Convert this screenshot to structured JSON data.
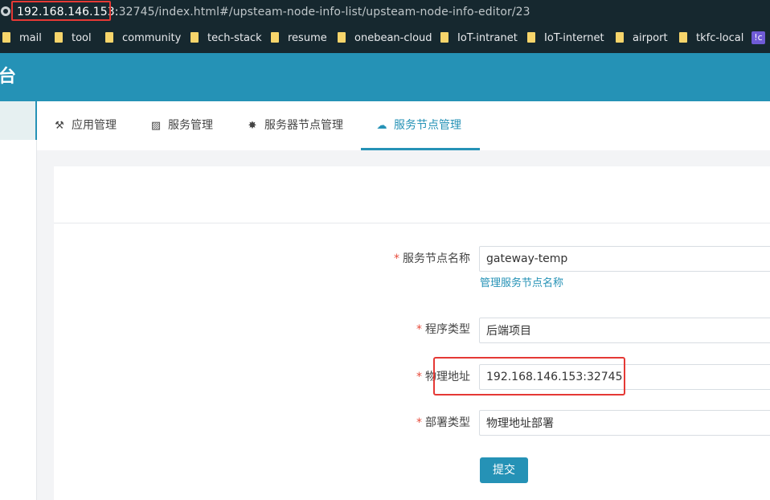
{
  "browser": {
    "url_host": "192.168.146.153:",
    "url_rest": "32745/index.html#/upsteam-node-info-list/upsteam-node-info-editor/23",
    "bookmarks": [
      "mail",
      "tool",
      "community",
      "tech-stack",
      "resume",
      "onebean-cloud",
      "IoT-intranet",
      "IoT-internet",
      "airport",
      "tkfc-local"
    ],
    "extension_glyph": "!c"
  },
  "header": {
    "title": "台"
  },
  "tabs": [
    {
      "label": "应用管理",
      "icon": "tools-icon"
    },
    {
      "label": "服务管理",
      "icon": "chart-icon"
    },
    {
      "label": "服务器节点管理",
      "icon": "server-icon"
    },
    {
      "label": "服务节点管理",
      "icon": "cloud-icon",
      "active": true
    }
  ],
  "form": {
    "node_name_label": "服务节点名称",
    "node_name_value": "gateway-temp",
    "node_name_hint": "管理服务节点名称",
    "program_type_label": "程序类型",
    "program_type_value": "后端项目",
    "address_label": "物理地址",
    "address_value": "192.168.146.153:32745",
    "deploy_type_label": "部署类型",
    "deploy_type_value": "物理地址部署",
    "required_mark": "*",
    "submit_label": "提交"
  },
  "colors": {
    "accent": "#2592b6",
    "browser_bg": "#16282f",
    "highlight": "#e53935",
    "required": "#e74c3c"
  }
}
